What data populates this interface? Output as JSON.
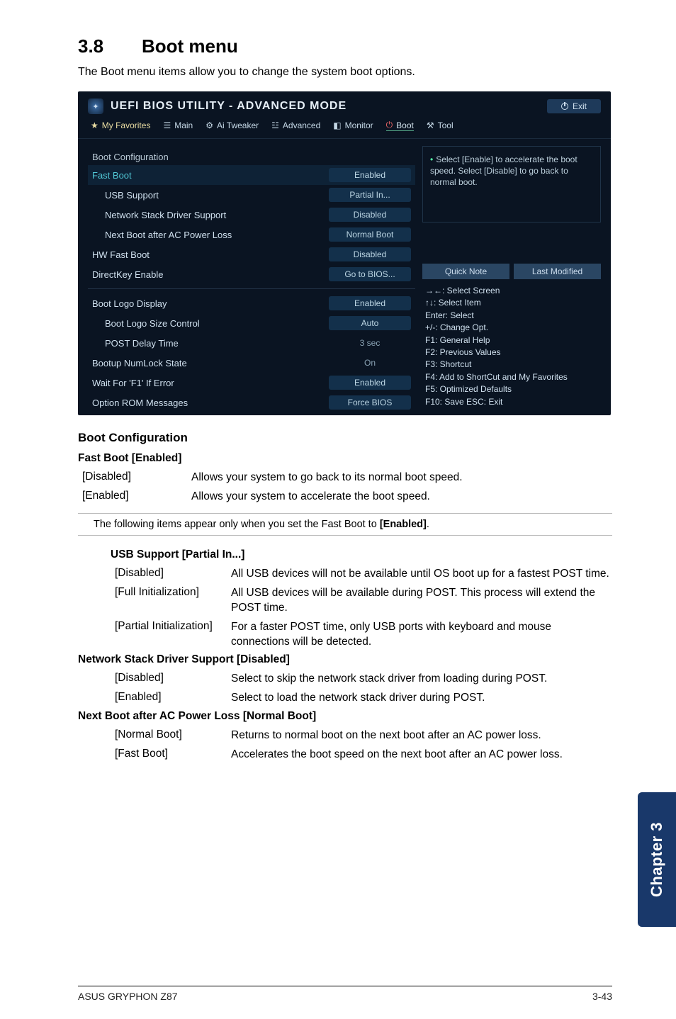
{
  "heading": {
    "num": "3.8",
    "title": "Boot menu"
  },
  "subtitle": "The Boot menu items allow you to change the system boot options.",
  "bios": {
    "title": "UEFI BIOS UTILITY - ADVANCED MODE",
    "exit": "Exit",
    "tabs": {
      "fav": "My Favorites",
      "main": "Main",
      "tweaker": "Ai Tweaker",
      "advanced": "Advanced",
      "monitor": "Monitor",
      "boot": "Boot",
      "tool": "Tool"
    },
    "sectionLabel": "Boot Configuration",
    "rows": {
      "fastBoot": {
        "label": "Fast Boot",
        "value": "Enabled"
      },
      "usbSupport": {
        "label": "USB Support",
        "value": "Partial In..."
      },
      "netStack": {
        "label": "Network Stack Driver Support",
        "value": "Disabled"
      },
      "nextBoot": {
        "label": "Next Boot after AC Power Loss",
        "value": "Normal Boot"
      },
      "hwFast": {
        "label": "HW Fast Boot",
        "value": "Disabled"
      },
      "directKey": {
        "label": "DirectKey Enable",
        "value": "Go to BIOS..."
      },
      "bootLogo": {
        "label": "Boot Logo Display",
        "value": "Enabled"
      },
      "logoSize": {
        "label": "Boot Logo Size Control",
        "value": "Auto"
      },
      "postDelay": {
        "label": "POST Delay Time",
        "value": "3 sec"
      },
      "numlock": {
        "label": "Bootup NumLock State",
        "value": "On"
      },
      "waitF1": {
        "label": "Wait For 'F1' If Error",
        "value": "Enabled"
      },
      "optRom": {
        "label": "Option ROM Messages",
        "value": "Force BIOS"
      }
    },
    "help": "Select [Enable] to accelerate the boot speed. Select [Disable] to go back to normal boot.",
    "quickNote": "Quick Note",
    "lastMod": "Last Modified",
    "hotkeys": {
      "arrows": "→←: Select Screen",
      "updown": "↑↓: Select Item",
      "enter": "Enter: Select",
      "plusminus": "+/-: Change Opt.",
      "f1": "F1: General Help",
      "f2": "F2: Previous Values",
      "f3": "F3: Shortcut",
      "f4": "F4: Add to ShortCut and My Favorites",
      "f5": "F5: Optimized Defaults",
      "f10": "F10: Save  ESC: Exit"
    }
  },
  "doc": {
    "bootConfig": "Boot Configuration",
    "fastBootH": "Fast Boot [Enabled]",
    "fastBoot": {
      "disabled": {
        "k": "[Disabled]",
        "v": "Allows your system to go back to its normal boot speed."
      },
      "enabled": {
        "k": "[Enabled]",
        "v": "Allows your system to accelerate the boot speed."
      }
    },
    "note": "The following items appear only when you set the Fast Boot to [Enabled].",
    "usbH": "USB Support [Partial In...]",
    "usb": {
      "disabled": {
        "k": "[Disabled]",
        "v": "All USB devices will not be available until OS boot up for a fastest POST time."
      },
      "full": {
        "k": "[Full Initialization]",
        "v": "All USB devices will be available during POST. This process will extend the POST time."
      },
      "partial": {
        "k": "[Partial Initialization]",
        "v": "For a faster POST time, only USB ports with keyboard and mouse connections will be detected."
      }
    },
    "netH": "Network Stack Driver Support [Disabled]",
    "net": {
      "disabled": {
        "k": "[Disabled]",
        "v": "Select to skip the network stack driver from loading during POST."
      },
      "enabled": {
        "k": "[Enabled]",
        "v": "Select to load the network stack driver during POST."
      }
    },
    "nextH": "Next Boot after AC Power Loss [Normal Boot]",
    "next": {
      "normal": {
        "k": "[Normal Boot]",
        "v": "Returns to normal boot on the next boot after an AC power loss."
      },
      "fast": {
        "k": "[Fast Boot]",
        "v": "Accelerates the boot speed on the next boot after an AC power loss."
      }
    }
  },
  "chapterTab": "Chapter 3",
  "footer": {
    "left": "ASUS GRYPHON Z87",
    "right": "3-43"
  }
}
